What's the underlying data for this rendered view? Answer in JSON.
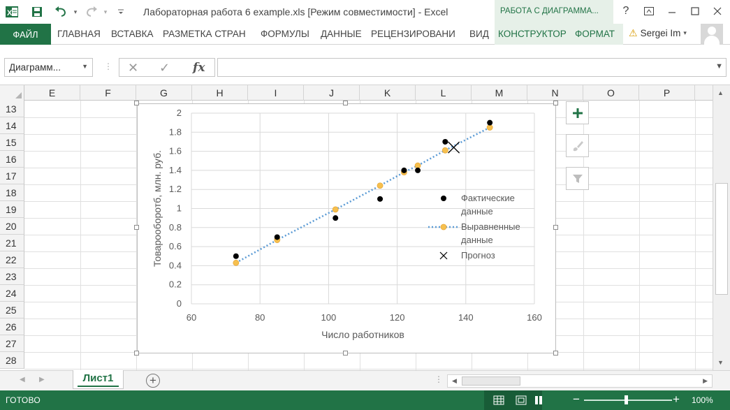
{
  "titlebar": {
    "title": "Лабораторная работа 6 example.xls  [Режим совместимости] - Excel",
    "context_group": "РАБОТА С ДИАГРАММА...",
    "buttons": [
      "?",
      "restore",
      "minimize",
      "maximize",
      "close"
    ]
  },
  "ribbon": {
    "file_tab": "ФАЙЛ",
    "tabs": [
      "ГЛАВНАЯ",
      "ВСТАВКА",
      "РАЗМЕТКА СТРАН",
      "ФОРМУЛЫ",
      "ДАННЫЕ",
      "РЕЦЕНЗИРОВАНИ",
      "ВИД"
    ],
    "context_tabs": [
      "КОНСТРУКТОР",
      "ФОРМАТ"
    ],
    "user_name": "Sergei Im"
  },
  "formula_bar": {
    "name_box": "Диаграмм...",
    "fx_label": "fx",
    "formula": ""
  },
  "grid": {
    "columns": [
      "E",
      "F",
      "G",
      "H",
      "I",
      "J",
      "K",
      "L",
      "M",
      "N",
      "O",
      "P"
    ],
    "rows": [
      "13",
      "14",
      "15",
      "16",
      "17",
      "18",
      "19",
      "20",
      "21",
      "22",
      "23",
      "24",
      "25",
      "26",
      "27",
      "28"
    ]
  },
  "sheets": {
    "tabs": [
      "Лист1"
    ],
    "active": "Лист1"
  },
  "status": {
    "text": "ГОТОВО",
    "zoom": "100%"
  },
  "colors": {
    "excel_green": "#217346",
    "actual_marker": "#000000",
    "fitted_marker": "#f6c04f",
    "trend_line": "#5b9bd5"
  },
  "chart_data": {
    "type": "scatter",
    "title": "",
    "xlabel": "Число работников",
    "ylabel": "Товарооборотб, млн. руб.",
    "xlim": [
      60,
      160
    ],
    "ylim": [
      0,
      2
    ],
    "x_ticks": [
      60,
      80,
      100,
      120,
      140,
      160
    ],
    "y_ticks": [
      0,
      0.2,
      0.4,
      0.6,
      0.8,
      1,
      1.2,
      1.4,
      1.6,
      1.8,
      2
    ],
    "grid": true,
    "legend_position": "right",
    "series": [
      {
        "name": "Фактические данные",
        "marker": "circle",
        "color": "#000000",
        "points": [
          [
            73,
            0.5
          ],
          [
            85,
            0.7
          ],
          [
            102,
            0.9
          ],
          [
            115,
            1.1
          ],
          [
            122,
            1.4
          ],
          [
            126,
            1.4
          ],
          [
            134,
            1.7
          ],
          [
            147,
            1.9
          ]
        ]
      },
      {
        "name": "Выравненные данные",
        "marker": "circle",
        "color": "#f6c04f",
        "line": "dotted",
        "line_color": "#5b9bd5",
        "points": [
          [
            73,
            0.43
          ],
          [
            85,
            0.67
          ],
          [
            102,
            0.99
          ],
          [
            115,
            1.24
          ],
          [
            122,
            1.38
          ],
          [
            126,
            1.45
          ],
          [
            134,
            1.61
          ],
          [
            147,
            1.85
          ]
        ]
      },
      {
        "name": "Прогноз",
        "marker": "x",
        "color": "#000000",
        "points": [
          [
            136.5,
            1.64
          ]
        ]
      }
    ]
  }
}
